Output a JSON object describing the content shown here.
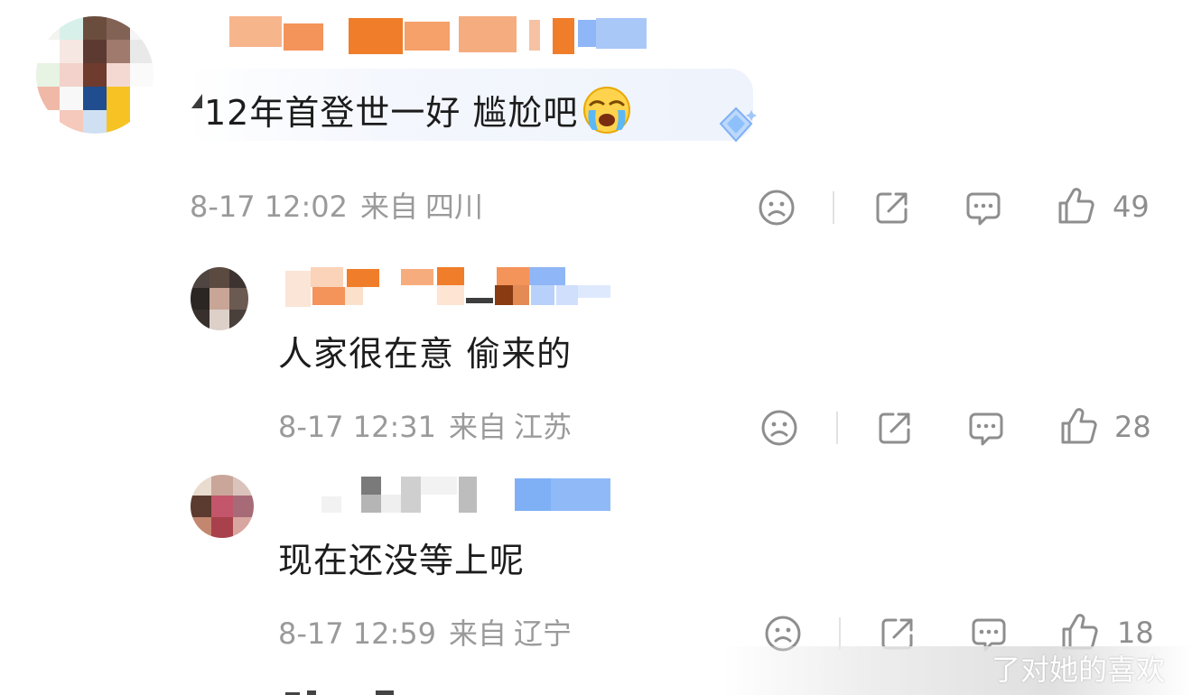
{
  "comments": [
    {
      "text": "12年首登世一好 尴尬吧",
      "date": "8-17 12:02",
      "from_label": "来自",
      "region": "四川",
      "likes": "49",
      "emoji": "loudly-crying-face"
    },
    {
      "text": "人家很在意 偷来的",
      "date": "8-17 12:31",
      "from_label": "来自",
      "region": "江苏",
      "likes": "28"
    },
    {
      "text": "现在还没等上呢",
      "date": "8-17 12:59",
      "from_label": "来自",
      "region": "辽宁",
      "likes": "18"
    }
  ],
  "watermark": "了对她的喜欢",
  "icons": {
    "dislike": "frown-face-icon",
    "share": "share-arrow-icon",
    "reply": "comment-bubble-icon",
    "like": "thumbs-up-icon"
  },
  "colors": {
    "text": "#1c1c1c",
    "meta": "#9a9a9a",
    "icon": "#8e8e8e",
    "bubble": "#eef3fc",
    "username_orange": "#f07d2a",
    "badge_blue": "#7fb0f5"
  }
}
